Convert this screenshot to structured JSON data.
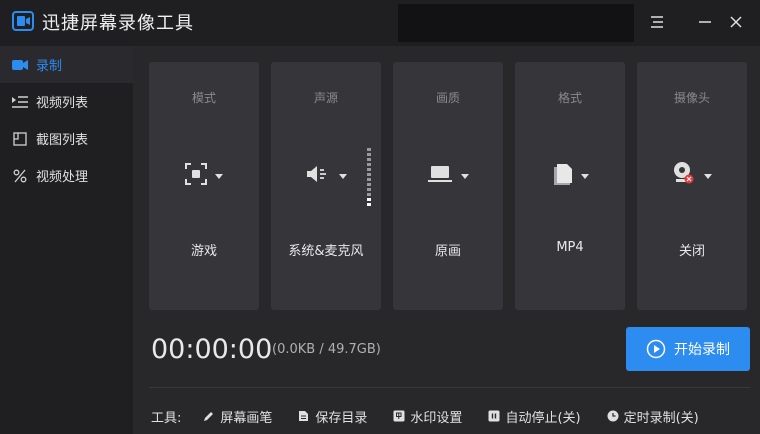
{
  "app": {
    "title": "迅捷屏幕录像工具"
  },
  "colors": {
    "accent": "#2d8cf0",
    "card_bg": "#36363a",
    "main_bg": "#28282b"
  },
  "sidebar": {
    "items": [
      {
        "label": "录制",
        "icon": "video-camera-icon",
        "active": true
      },
      {
        "label": "视频列表",
        "icon": "video-list-icon",
        "active": false
      },
      {
        "label": "截图列表",
        "icon": "screenshot-list-icon",
        "active": false
      },
      {
        "label": "视频处理",
        "icon": "video-process-icon",
        "active": false
      }
    ]
  },
  "cards": [
    {
      "title": "模式",
      "value": "游戏",
      "icon": "mode-icon"
    },
    {
      "title": "声源",
      "value": "系统&麦克风",
      "icon": "speaker-icon"
    },
    {
      "title": "画质",
      "value": "原画",
      "icon": "laptop-icon"
    },
    {
      "title": "格式",
      "value": "MP4",
      "icon": "file-icon"
    },
    {
      "title": "摄像头",
      "value": "关闭",
      "icon": "webcam-icon"
    }
  ],
  "recording": {
    "timer": "00:00:00",
    "size": "(0.0KB / 49.7GB)",
    "start_label": "开始录制"
  },
  "tools": {
    "label": "工具:",
    "items": [
      {
        "label": "屏幕画笔",
        "icon": "pen-icon"
      },
      {
        "label": "保存目录",
        "icon": "folder-doc-icon"
      },
      {
        "label": "水印设置",
        "icon": "watermark-icon"
      },
      {
        "label": "自动停止(关)",
        "icon": "pause-icon"
      },
      {
        "label": "定时录制(关)",
        "icon": "clock-icon"
      }
    ]
  }
}
